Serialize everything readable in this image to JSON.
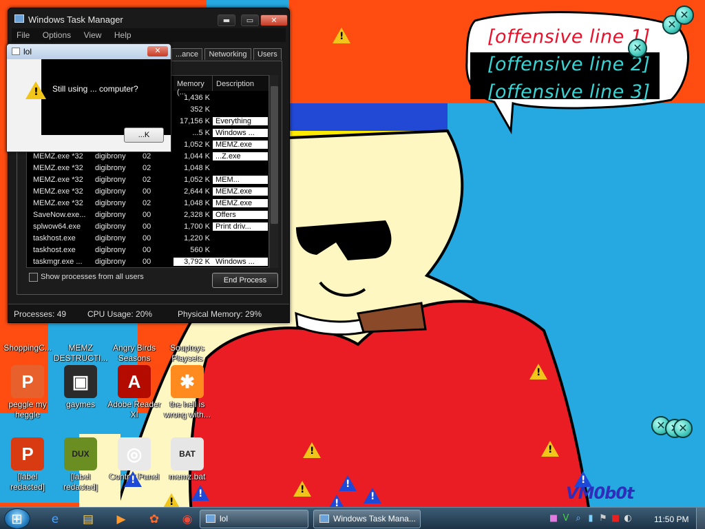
{
  "colors": {
    "wall_orange": "#ff4d12",
    "wall_blue": "#25a9e0",
    "bubble_text": "#3ad4d4",
    "bubble_text_first": "#e8112b",
    "watermark": "#2f2dba"
  },
  "wallpaper": {
    "speech_bubble": [
      "[offensive line 1]",
      "[offensive line 2]",
      "[offensive line 3]"
    ],
    "watermark": "VM0b0t"
  },
  "desktop_icons": [
    {
      "name": "shopping-icon",
      "label": "ShoppingC...",
      "glyph": "",
      "color": "#888888"
    },
    {
      "name": "memz-icon",
      "label": "MEMZ DESTRUCTI...",
      "glyph": "",
      "color": "#888888"
    },
    {
      "name": "angry-birds-icon",
      "label": "Angry Birds Seasons",
      "glyph": "",
      "color": "#888888"
    },
    {
      "name": "souptoys-icon",
      "label": "Souptoys Playsets",
      "glyph": "",
      "color": "#888888"
    },
    {
      "name": "peggle-icon",
      "label": "peggle my heggle",
      "glyph": "P",
      "color": "#e8612c"
    },
    {
      "name": "games-icon",
      "label": "gaymes",
      "glyph": "▣",
      "color": "#2b2b2b"
    },
    {
      "name": "adobe-reader-icon",
      "label": "Adobe Reader XI",
      "glyph": "A",
      "color": "#b30b00"
    },
    {
      "name": "uc-browser-icon",
      "label": "the hell is wrong with...",
      "glyph": "✱",
      "color": "#ff8a1d"
    },
    {
      "name": "peggle-nights-icon",
      "label": "[label redacted]",
      "glyph": "P",
      "color": "#d83a12"
    },
    {
      "name": "dux-icon",
      "label": "[label redacted]",
      "glyph": "DUX",
      "color": "#6b8e23"
    },
    {
      "name": "control-panel-icon",
      "label": "Control Panel",
      "glyph": "◎",
      "color": "#e9e9e9"
    },
    {
      "name": "memz-bat-icon",
      "label": "memz.bat",
      "glyph": "BAT",
      "color": "#e6e6e6"
    }
  ],
  "task_manager": {
    "title": "Windows Task Manager",
    "window_buttons": {
      "minimize": "▬",
      "maximize": "▭",
      "close": "✕"
    },
    "menu": [
      "File",
      "Options",
      "View",
      "Help"
    ],
    "tabs": [
      "...ance",
      "Networking",
      "Users"
    ],
    "columns": [
      "Memory (...",
      "Description"
    ],
    "rows": [
      {
        "name": "",
        "user": "",
        "cpu": "",
        "mem": "1,436 K",
        "desc": ""
      },
      {
        "name": "",
        "user": "",
        "cpu": "",
        "mem": "352 K",
        "desc": ""
      },
      {
        "name": "",
        "user": "",
        "cpu": "",
        "mem": "17,156 K",
        "desc": "Everything"
      },
      {
        "name": "",
        "user": "",
        "cpu": "",
        "mem": "...5 K",
        "desc": "Windows ..."
      },
      {
        "name": "",
        "user": "",
        "cpu": "",
        "mem": "1,052 K",
        "desc": "MEMZ.exe"
      },
      {
        "name": "MEMZ.exe *32",
        "user": "digibrony",
        "cpu": "02",
        "mem": "1,044 K",
        "desc": "...Z.exe"
      },
      {
        "name": "MEMZ.exe *32",
        "user": "digibrony",
        "cpu": "02",
        "mem": "1,048 K",
        "desc": ""
      },
      {
        "name": "MEMZ.exe *32",
        "user": "digibrony",
        "cpu": "02",
        "mem": "1,052 K",
        "desc": "MEM..."
      },
      {
        "name": "MEMZ.exe *32",
        "user": "digibrony",
        "cpu": "00",
        "mem": "2,644 K",
        "desc": "MEMZ.exe"
      },
      {
        "name": "MEMZ.exe *32",
        "user": "digibrony",
        "cpu": "02",
        "mem": "1,048 K",
        "desc": "MEMZ.exe"
      },
      {
        "name": "SaveNow.exe...",
        "user": "digibrony",
        "cpu": "00",
        "mem": "2,328 K",
        "desc": "Offers"
      },
      {
        "name": "splwow64.exe",
        "user": "digibrony",
        "cpu": "00",
        "mem": "1,700 K",
        "desc": "Print driv..."
      },
      {
        "name": "taskhost.exe",
        "user": "digibrony",
        "cpu": "00",
        "mem": "1,220 K",
        "desc": ""
      },
      {
        "name": "taskhost.exe",
        "user": "digibrony",
        "cpu": "00",
        "mem": "560 K",
        "desc": ""
      },
      {
        "name": "taskmgr.exe ...",
        "user": "digibrony",
        "cpu": "00",
        "mem": "3,792 K",
        "desc": "Windows ..."
      }
    ],
    "show_all_label": "Show processes from all users",
    "end_process_label": "End Process",
    "status": {
      "processes": "Processes: 49",
      "cpu": "CPU Usage: 20%",
      "memory": "Physical Memory: 29%"
    }
  },
  "lol_dialog": {
    "title": "lol",
    "close": "✕",
    "message": "Still using ... computer?",
    "ok_label": "...K"
  },
  "taskbar": {
    "pinned": [
      {
        "name": "internet-explorer-icon",
        "glyph": "e",
        "color": "#4aa3ff"
      },
      {
        "name": "explorer-folder-icon",
        "glyph": "▤",
        "color": "#f3d070"
      },
      {
        "name": "media-player-icon",
        "glyph": "▶",
        "color": "#ff9b2e"
      },
      {
        "name": "paint-icon",
        "glyph": "✿",
        "color": "#ff6b2e"
      },
      {
        "name": "chrome-icon",
        "glyph": "◉",
        "color": "#e84a3a"
      }
    ],
    "tasks": [
      {
        "name": "taskbar-lol",
        "label": "lol"
      },
      {
        "name": "taskbar-task-manager",
        "label": "Windows Task Mana..."
      }
    ],
    "tray": [
      {
        "name": "tray-square-icon",
        "glyph": "■",
        "color": "#e07be0"
      },
      {
        "name": "tray-v-icon",
        "glyph": "V",
        "color": "#47d147"
      },
      {
        "name": "tray-search-icon",
        "glyph": "⌕",
        "color": "#6fb6ff"
      },
      {
        "name": "tray-network-icon",
        "glyph": "▮",
        "color": "#7ad0ff"
      },
      {
        "name": "tray-flag-icon",
        "glyph": "⚑",
        "color": "#cccccc"
      },
      {
        "name": "tray-red-icon",
        "glyph": "■",
        "color": "#e82020"
      },
      {
        "name": "tray-volume-icon",
        "glyph": "◐",
        "color": "#dddddd"
      }
    ],
    "clock": "11:50 PM"
  }
}
